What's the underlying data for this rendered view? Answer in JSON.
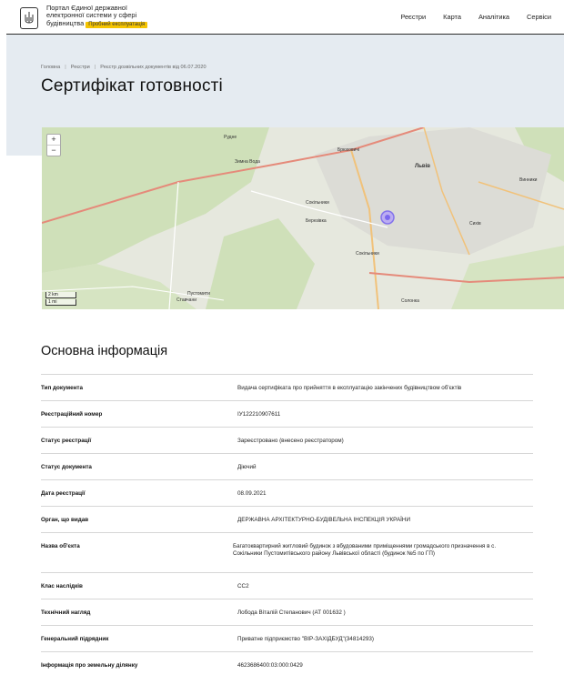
{
  "header": {
    "brand_line1": "Портал Єдиної державної",
    "brand_line2": "електронної системи у сфері",
    "brand_line3": "будівництва",
    "beta_badge": "Пробний експлуатація",
    "nav": [
      "Реєстри",
      "Карта",
      "Аналітика",
      "Сервіси"
    ]
  },
  "breadcrumb": [
    "Головна",
    "Реєстри",
    "Реєстр дозвільних документів від 06.07.2020"
  ],
  "page_title": "Сертифікат готовності",
  "map": {
    "zoom_in": "+",
    "zoom_out": "−",
    "scale_km": "2 km",
    "scale_mi": "1 mi",
    "labels": [
      "Рудне",
      "Брюховичі",
      "Сокільники",
      "Львів",
      "Сихів",
      "Винники",
      "Пустомити",
      "Зимна Вода",
      "Ставчани",
      "Солонка",
      "Березівка",
      "Сокільники"
    ],
    "marker_color": "#7b68ee"
  },
  "section_title": "Основна інформація",
  "details": [
    {
      "key": "Тип документа",
      "value": "Видача сертифіката про прийняття в експлуатацію закінчених будівництвом об'єктів"
    },
    {
      "key": "Реєстраційний номер",
      "value": "ІУ122210907611"
    },
    {
      "key": "Статус реєстрації",
      "value": "Зареєстровано (внесено реєстратором)"
    },
    {
      "key": "Статус документа",
      "value": "Діючий"
    },
    {
      "key": "Дата реєстрації",
      "value": "08.09.2021"
    },
    {
      "key": "Орган, що видав",
      "value": "ДЕРЖАВНА АРХІТЕКТУРНО-БУДІВЕЛЬНА ІНСПЕКЦІЯ УКРАЇНИ"
    },
    {
      "key": "Назва об'єкта",
      "value": "Багатоквартирний житловий будинок з вбудованими приміщеннями громадського призначення в с. Сокільники Пустомитівського району Львівської області (будинок №5 по ГП)"
    },
    {
      "key": "Клас наслідків",
      "value": "СС2"
    },
    {
      "key": "Технічний нагляд",
      "value": "Лобода Віталій Степанович (АТ 001632 )"
    },
    {
      "key": "Генеральний підрядник",
      "value": "Приватне підприємство \"ВІР-ЗАХІДБУД\"(34814293)"
    },
    {
      "key": "Інформація про земельну ділянку",
      "value": "4623686400:03:000:0429"
    }
  ]
}
